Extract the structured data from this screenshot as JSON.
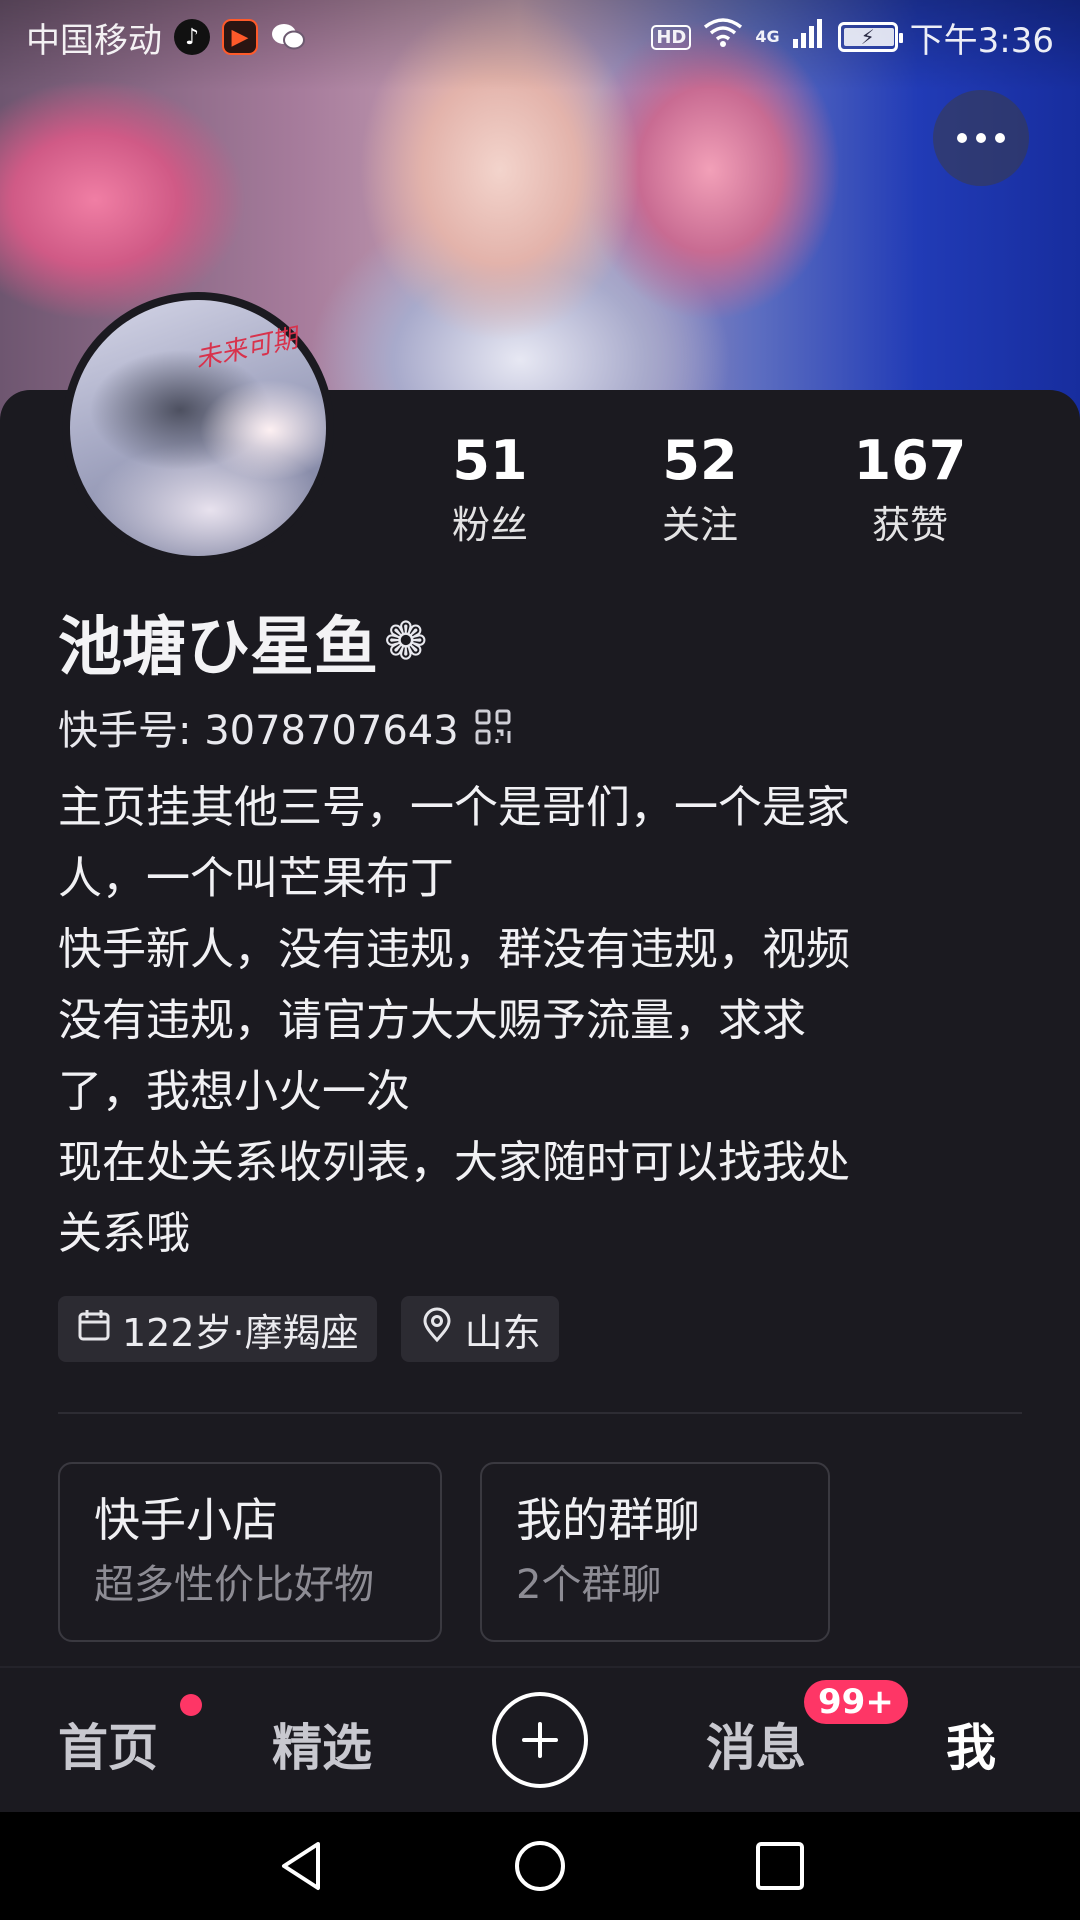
{
  "status_bar": {
    "carrier": "中国移动",
    "hd": "HD",
    "network": "4G",
    "time": "下午3:36",
    "icons": [
      "tiktok-icon",
      "video-app-icon",
      "wechat-icon",
      "wifi-icon",
      "signal-icon",
      "battery-charging-icon"
    ]
  },
  "profile": {
    "nickname": "池塘ひ星鱼",
    "nickname_symbol": "❁",
    "id_label": "快手号: 3078707643",
    "avatar_scribble": "未来可期",
    "stats": [
      {
        "value": "51",
        "label": "粉丝"
      },
      {
        "value": "52",
        "label": "关注"
      },
      {
        "value": "167",
        "label": "获赞"
      }
    ],
    "bio_lines": [
      "主页挂其他三号，一个是哥们，一个是家",
      "人，一个叫芒果布丁",
      "快手新人，没有违规，群没有违规，视频",
      "没有违规，请官方大大赐予流量，求求",
      "了，我想小火一次",
      "现在处关系收列表，大家随时可以找我处",
      "关系哦"
    ],
    "tags": {
      "age_sign": "122岁·摩羯座",
      "location": "山东"
    }
  },
  "entries": [
    {
      "title": "快手小店",
      "subtitle": "超多性价比好物"
    },
    {
      "title": "我的群聊",
      "subtitle": "2个群聊"
    }
  ],
  "tab_bar": {
    "home": "首页",
    "featured": "精选",
    "messages": "消息",
    "messages_badge": "99+",
    "me": "我",
    "active": "me",
    "accent": "#fe3666"
  }
}
